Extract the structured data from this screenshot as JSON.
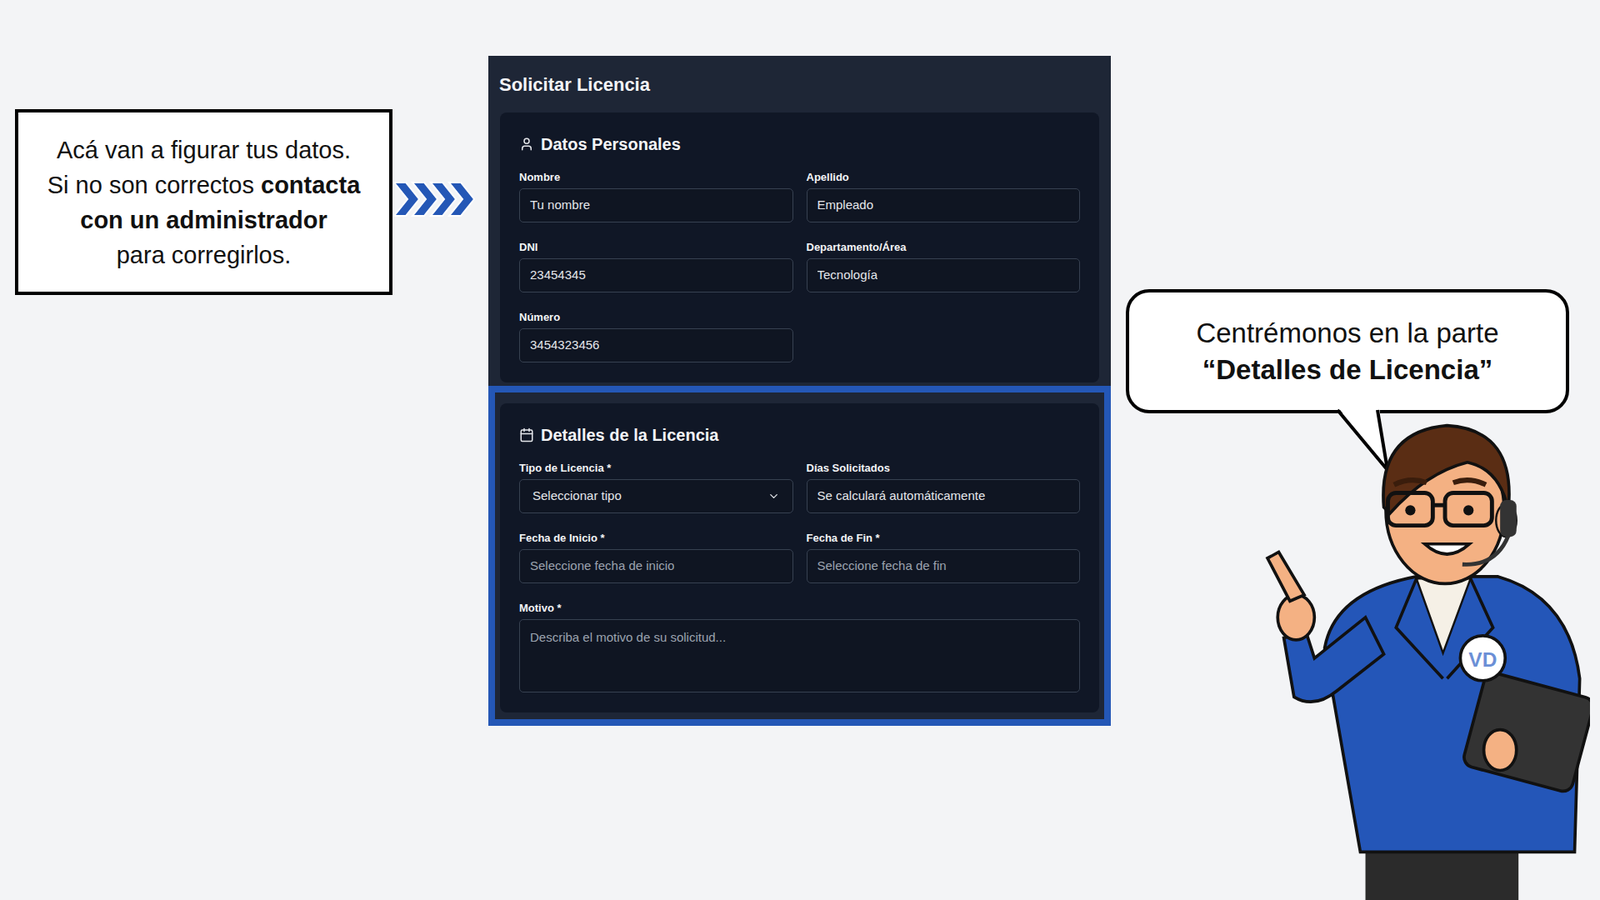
{
  "callout": {
    "lines": [
      [
        {
          "text": "Acá van a figurar tus datos.",
          "bold": false
        }
      ],
      [
        {
          "text": "Si no son correctos ",
          "bold": false
        },
        {
          "text": "contacta",
          "bold": true
        }
      ],
      [
        {
          "text": "con un administrador",
          "bold": true
        }
      ],
      [
        {
          "text": "para corregirlos.",
          "bold": false
        }
      ]
    ]
  },
  "form": {
    "title": "Solicitar Licencia",
    "sections": [
      {
        "title": "Datos Personales",
        "highlighted": false,
        "fields": [
          {
            "label": "Nombre",
            "value": "Tu nombre",
            "kind": "input"
          },
          {
            "label": "Apellido",
            "value": "Empleado",
            "kind": "input"
          },
          {
            "label": "DNI",
            "value": "23454345",
            "kind": "input"
          },
          {
            "label": "Departamento/Área",
            "value": "Tecnología",
            "kind": "input"
          },
          {
            "label": "Número",
            "value": "3454323456",
            "kind": "input"
          }
        ]
      },
      {
        "title": "Detalles de la Licencia",
        "highlighted": true,
        "fields": [
          {
            "label": "Tipo de Licencia *",
            "value": "Seleccionar tipo",
            "kind": "select"
          },
          {
            "label": "Días Solicitados",
            "value": "Se calculará automáticamente",
            "kind": "input"
          },
          {
            "label": "Fecha de Inicio *",
            "placeholder": "Seleccione fecha de inicio",
            "kind": "input"
          },
          {
            "label": "Fecha de Fin *",
            "placeholder": "Seleccione fecha de fin",
            "kind": "input"
          },
          {
            "label": "Motivo *",
            "placeholder": "Describa el motivo de su solicitud...",
            "kind": "textarea"
          }
        ]
      }
    ]
  },
  "bubble": {
    "lines": [
      {
        "text": "Centrémonos en la parte",
        "bold": false
      },
      {
        "text": "“Detalles de Licencia”",
        "bold": true
      }
    ]
  },
  "character": {
    "badge": "VD"
  }
}
